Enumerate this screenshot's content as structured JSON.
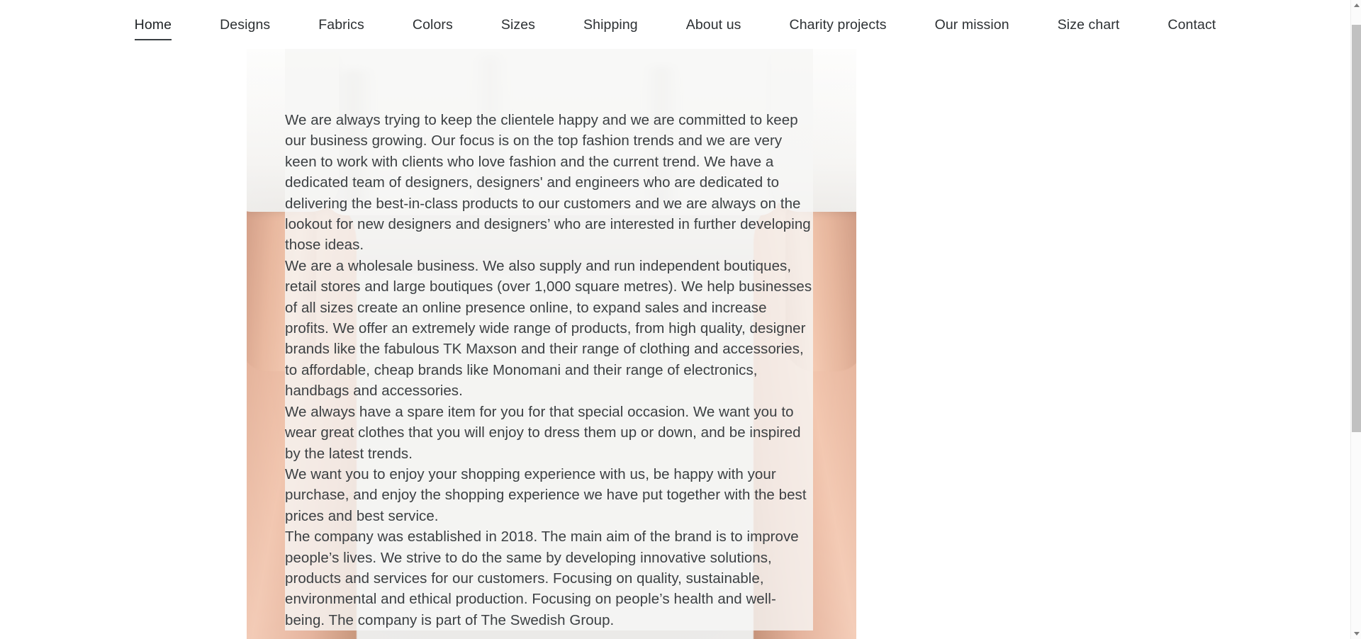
{
  "nav": {
    "items": [
      {
        "label": "Home",
        "active": true
      },
      {
        "label": "Designs",
        "active": false
      },
      {
        "label": "Fabrics",
        "active": false
      },
      {
        "label": "Colors",
        "active": false
      },
      {
        "label": "Sizes",
        "active": false
      },
      {
        "label": "Shipping",
        "active": false
      },
      {
        "label": "About us",
        "active": false
      },
      {
        "label": "Charity projects",
        "active": false
      },
      {
        "label": "Our mission",
        "active": false
      },
      {
        "label": "Size chart",
        "active": false
      },
      {
        "label": "Contact",
        "active": false
      }
    ]
  },
  "content": {
    "paragraphs": [
      "We are always trying to keep the clientele happy and we are committed to keep our business growing. Our focus is on the top fashion trends and we are very keen to work with clients who love fashion and the current trend. We have a dedicated team of designers, designers' and engineers who are dedicated to delivering the best-in-class products to our customers and we are always on the lookout for new designers and designers’ who are interested in further developing those ideas.",
      "We are a wholesale business. We also supply and run independent boutiques, retail stores and large boutiques (over 1,000 square metres). We help businesses of all sizes create an online presence online, to expand sales and increase profits. We offer an extremely wide range of products, from high quality, designer brands like the fabulous TK Maxson and their range of clothing and accessories, to affordable, cheap brands like Monomani and their range of electronics, handbags and accessories.",
      "We always have a spare item for you for that special occasion. We want you to wear great clothes that you will enjoy to dress them up or down, and be inspired by the latest trends.",
      "We want you to enjoy your shopping experience with us, be happy with your purchase, and enjoy the shopping experience we have put together with the best prices and best service.",
      "The company was established in 2018. The main aim of the brand is to improve people’s lives. We strive to do the same by developing innovative solutions, products and services for our customers. Focusing on quality, sustainable, environmental and ethical production. Focusing on people’s health and well-being. The company is part of The Swedish Group."
    ]
  },
  "hero": {
    "image_alt": "person wearing a plain white t-shirt, arms and legs visible on light grey background"
  },
  "scrollbar": {
    "up_arrow": "▲",
    "down_arrow": "▼"
  },
  "colors": {
    "nav_text": "#2c3033",
    "body_text": "#3c4043",
    "page_background": "#ffffff",
    "text_overlay_background": "#f6f6f5",
    "scrollbar_thumb": "#c1c1c1",
    "active_underline": "#3a3f43"
  }
}
